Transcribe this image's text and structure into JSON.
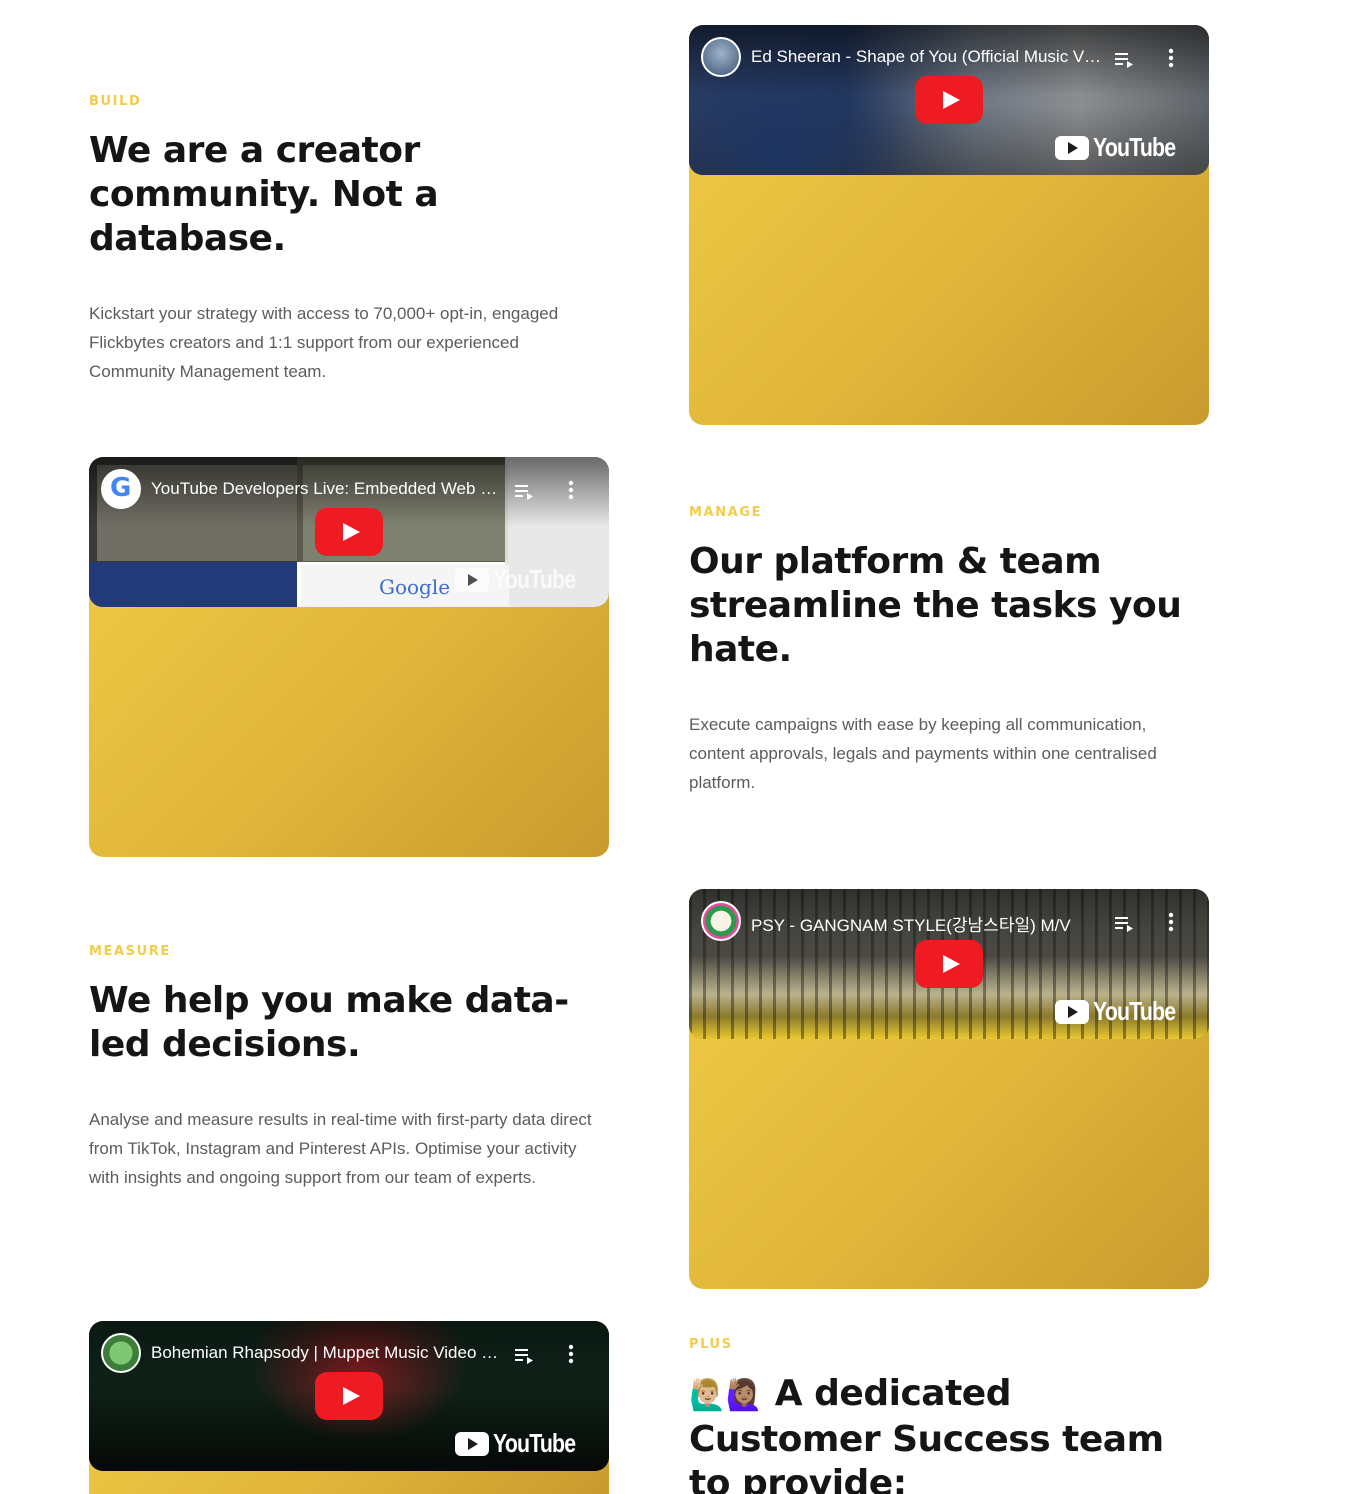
{
  "sections": [
    {
      "eyebrow": "BUILD",
      "headline": "We are a creator community. Not a database.",
      "body": "Kickstart your strategy with access to 70,000+ opt-in, engaged Flickbytes creators and 1:1 support from our experienced Community Management team."
    },
    {
      "eyebrow": "MANAGE",
      "headline": "Our platform & team streamline the tasks you hate.",
      "body": "Execute campaigns with ease by keeping all communication, content approvals, legals and payments within one centralised platform."
    },
    {
      "eyebrow": "MEASURE",
      "headline": "We help you make data-led decisions.",
      "body": "Analyse and measure results in real-time with first-party data direct from TikTok, Instagram and Pinterest APIs. Optimise your activity with insights and ongoing support from our team of experts."
    },
    {
      "eyebrow": "PLUS",
      "emojis": "🙋🏼‍♂️🙋🏽‍♀️",
      "headline": "A dedicated Customer Success team to provide:"
    }
  ],
  "videos": [
    {
      "title": "Ed Sheeran - Shape of You (Official Music Video)",
      "logo": "YouTube"
    },
    {
      "title": "YouTube Developers Live: Embedded Web Player Customization",
      "logo": "YouTube"
    },
    {
      "title": "PSY - GANGNAM STYLE(강남스타일) M/V",
      "logo": "YouTube"
    },
    {
      "title": "Bohemian Rhapsody | Muppet Music Video | The Muppets",
      "logo": "YouTube"
    }
  ],
  "colors": {
    "accent": "#f1cd4a",
    "card_gold": "#e0b63a",
    "play_red": "#ee1c22"
  }
}
